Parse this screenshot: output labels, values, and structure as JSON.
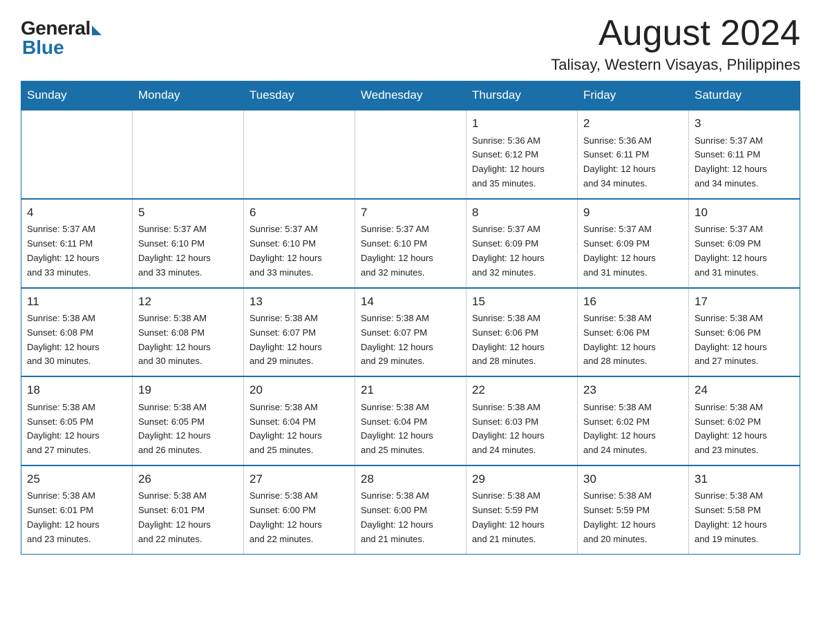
{
  "logo": {
    "general": "General",
    "blue": "Blue"
  },
  "header": {
    "month": "August 2024",
    "location": "Talisay, Western Visayas, Philippines"
  },
  "weekdays": [
    "Sunday",
    "Monday",
    "Tuesday",
    "Wednesday",
    "Thursday",
    "Friday",
    "Saturday"
  ],
  "weeks": [
    [
      {
        "day": "",
        "info": ""
      },
      {
        "day": "",
        "info": ""
      },
      {
        "day": "",
        "info": ""
      },
      {
        "day": "",
        "info": ""
      },
      {
        "day": "1",
        "info": "Sunrise: 5:36 AM\nSunset: 6:12 PM\nDaylight: 12 hours\nand 35 minutes."
      },
      {
        "day": "2",
        "info": "Sunrise: 5:36 AM\nSunset: 6:11 PM\nDaylight: 12 hours\nand 34 minutes."
      },
      {
        "day": "3",
        "info": "Sunrise: 5:37 AM\nSunset: 6:11 PM\nDaylight: 12 hours\nand 34 minutes."
      }
    ],
    [
      {
        "day": "4",
        "info": "Sunrise: 5:37 AM\nSunset: 6:11 PM\nDaylight: 12 hours\nand 33 minutes."
      },
      {
        "day": "5",
        "info": "Sunrise: 5:37 AM\nSunset: 6:10 PM\nDaylight: 12 hours\nand 33 minutes."
      },
      {
        "day": "6",
        "info": "Sunrise: 5:37 AM\nSunset: 6:10 PM\nDaylight: 12 hours\nand 33 minutes."
      },
      {
        "day": "7",
        "info": "Sunrise: 5:37 AM\nSunset: 6:10 PM\nDaylight: 12 hours\nand 32 minutes."
      },
      {
        "day": "8",
        "info": "Sunrise: 5:37 AM\nSunset: 6:09 PM\nDaylight: 12 hours\nand 32 minutes."
      },
      {
        "day": "9",
        "info": "Sunrise: 5:37 AM\nSunset: 6:09 PM\nDaylight: 12 hours\nand 31 minutes."
      },
      {
        "day": "10",
        "info": "Sunrise: 5:37 AM\nSunset: 6:09 PM\nDaylight: 12 hours\nand 31 minutes."
      }
    ],
    [
      {
        "day": "11",
        "info": "Sunrise: 5:38 AM\nSunset: 6:08 PM\nDaylight: 12 hours\nand 30 minutes."
      },
      {
        "day": "12",
        "info": "Sunrise: 5:38 AM\nSunset: 6:08 PM\nDaylight: 12 hours\nand 30 minutes."
      },
      {
        "day": "13",
        "info": "Sunrise: 5:38 AM\nSunset: 6:07 PM\nDaylight: 12 hours\nand 29 minutes."
      },
      {
        "day": "14",
        "info": "Sunrise: 5:38 AM\nSunset: 6:07 PM\nDaylight: 12 hours\nand 29 minutes."
      },
      {
        "day": "15",
        "info": "Sunrise: 5:38 AM\nSunset: 6:06 PM\nDaylight: 12 hours\nand 28 minutes."
      },
      {
        "day": "16",
        "info": "Sunrise: 5:38 AM\nSunset: 6:06 PM\nDaylight: 12 hours\nand 28 minutes."
      },
      {
        "day": "17",
        "info": "Sunrise: 5:38 AM\nSunset: 6:06 PM\nDaylight: 12 hours\nand 27 minutes."
      }
    ],
    [
      {
        "day": "18",
        "info": "Sunrise: 5:38 AM\nSunset: 6:05 PM\nDaylight: 12 hours\nand 27 minutes."
      },
      {
        "day": "19",
        "info": "Sunrise: 5:38 AM\nSunset: 6:05 PM\nDaylight: 12 hours\nand 26 minutes."
      },
      {
        "day": "20",
        "info": "Sunrise: 5:38 AM\nSunset: 6:04 PM\nDaylight: 12 hours\nand 25 minutes."
      },
      {
        "day": "21",
        "info": "Sunrise: 5:38 AM\nSunset: 6:04 PM\nDaylight: 12 hours\nand 25 minutes."
      },
      {
        "day": "22",
        "info": "Sunrise: 5:38 AM\nSunset: 6:03 PM\nDaylight: 12 hours\nand 24 minutes."
      },
      {
        "day": "23",
        "info": "Sunrise: 5:38 AM\nSunset: 6:02 PM\nDaylight: 12 hours\nand 24 minutes."
      },
      {
        "day": "24",
        "info": "Sunrise: 5:38 AM\nSunset: 6:02 PM\nDaylight: 12 hours\nand 23 minutes."
      }
    ],
    [
      {
        "day": "25",
        "info": "Sunrise: 5:38 AM\nSunset: 6:01 PM\nDaylight: 12 hours\nand 23 minutes."
      },
      {
        "day": "26",
        "info": "Sunrise: 5:38 AM\nSunset: 6:01 PM\nDaylight: 12 hours\nand 22 minutes."
      },
      {
        "day": "27",
        "info": "Sunrise: 5:38 AM\nSunset: 6:00 PM\nDaylight: 12 hours\nand 22 minutes."
      },
      {
        "day": "28",
        "info": "Sunrise: 5:38 AM\nSunset: 6:00 PM\nDaylight: 12 hours\nand 21 minutes."
      },
      {
        "day": "29",
        "info": "Sunrise: 5:38 AM\nSunset: 5:59 PM\nDaylight: 12 hours\nand 21 minutes."
      },
      {
        "day": "30",
        "info": "Sunrise: 5:38 AM\nSunset: 5:59 PM\nDaylight: 12 hours\nand 20 minutes."
      },
      {
        "day": "31",
        "info": "Sunrise: 5:38 AM\nSunset: 5:58 PM\nDaylight: 12 hours\nand 19 minutes."
      }
    ]
  ]
}
